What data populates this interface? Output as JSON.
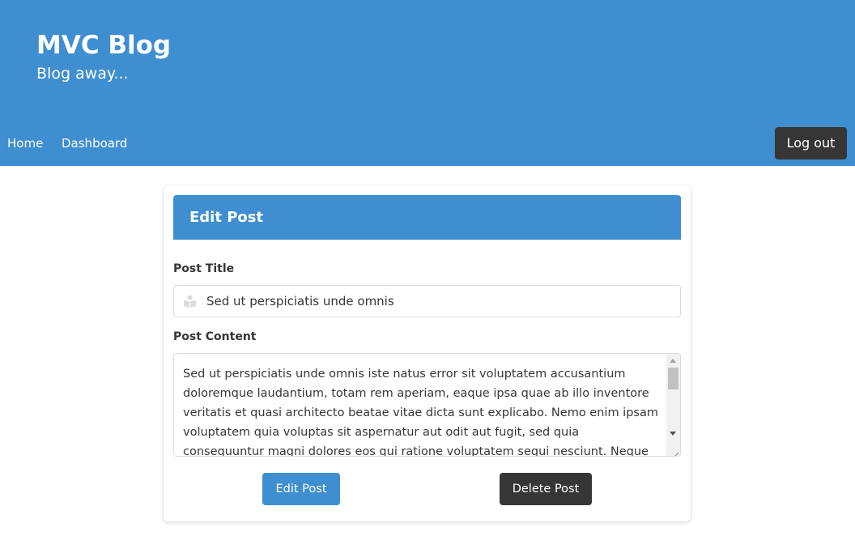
{
  "header": {
    "title": "MVC Blog",
    "subtitle": "Blog away...",
    "nav": {
      "home": "Home",
      "dashboard": "Dashboard",
      "logout": "Log out"
    }
  },
  "form": {
    "heading": "Edit Post",
    "title_label": "Post Title",
    "title_value": "Sed ut perspiciatis unde omnis",
    "title_icon": "book-reader-icon",
    "content_label": "Post Content",
    "content_value": "Sed ut perspiciatis unde omnis iste natus error sit voluptatem accusantium doloremque laudantium, totam rem aperiam, eaque ipsa quae ab illo inventore veritatis et quasi architecto beatae vitae dicta sunt explicabo. Nemo enim ipsam voluptatem quia voluptas sit aspernatur aut odit aut fugit, sed quia consequuntur magni dolores eos qui ratione voluptatem sequi nesciunt. Neque porro quisquam",
    "edit_button": "Edit Post",
    "delete_button": "Delete Post"
  },
  "colors": {
    "primary": "#3e8ed0",
    "dark": "#363636",
    "white": "#ffffff",
    "border": "#dbdbdb"
  }
}
